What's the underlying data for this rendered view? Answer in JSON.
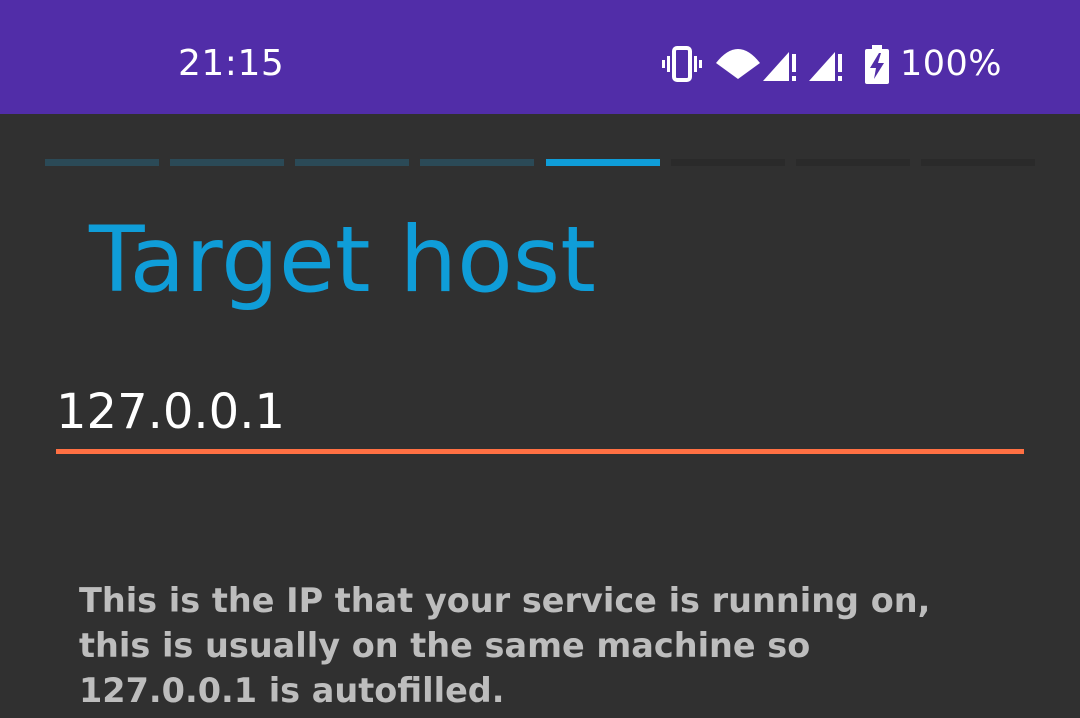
{
  "status_bar": {
    "time": "21:15",
    "battery_percent": "100%",
    "background_color": "#512da8",
    "icons": [
      "vibrate-icon",
      "wifi-icon",
      "signal-1-icon",
      "signal-2-icon",
      "battery-charging-icon"
    ]
  },
  "wizard": {
    "total_steps": 8,
    "current_step": 5,
    "title": "Target host",
    "accent_color": "#0f9dd8"
  },
  "host_field": {
    "value": "127.0.0.1",
    "underline_color": "#ff7043"
  },
  "help": {
    "text": "This is the IP that your service is running on, this is usually on the same machine so 127.0.0.1 is autofilled."
  }
}
